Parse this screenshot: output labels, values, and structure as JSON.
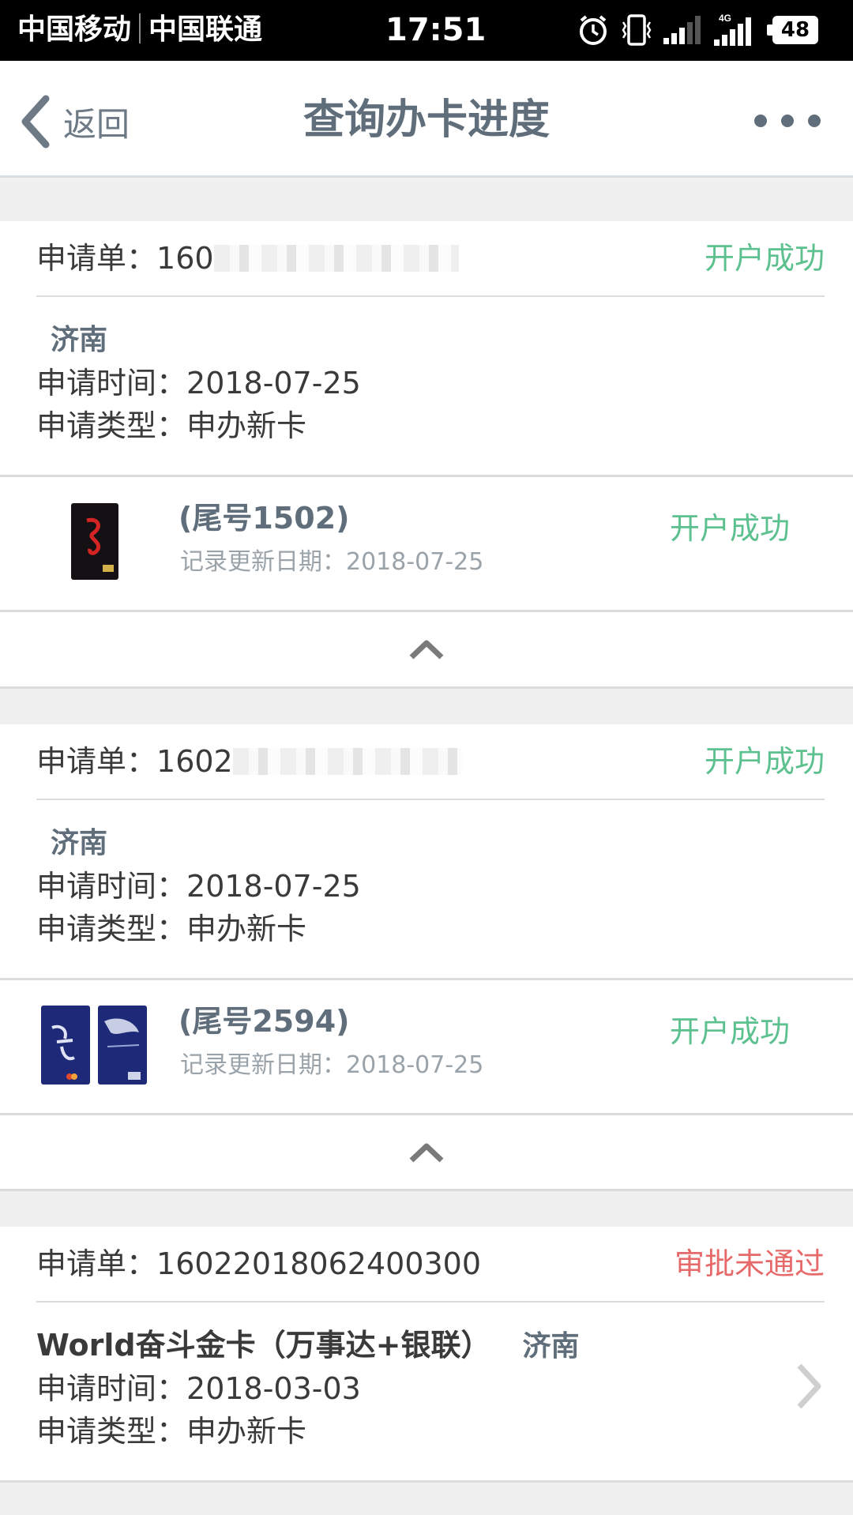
{
  "status_bar": {
    "carrier1": "中国移动",
    "carrier2": "中国联通",
    "time": "17:51",
    "network": "4G",
    "battery": "48"
  },
  "nav": {
    "back_label": "返回",
    "title": "查询办卡进度"
  },
  "applications": [
    {
      "label": "申请单：",
      "number_visible": "160",
      "status": "开户成功",
      "city": "济南",
      "apply_time_label": "申请时间：",
      "apply_time": "2018-07-25",
      "apply_type_label": "申请类型：",
      "apply_type": "申办新卡",
      "card_tail": "(尾号1502)",
      "update_label": "记录更新日期：",
      "update_date": "2018-07-25",
      "card_status": "开户成功"
    },
    {
      "label": "申请单：",
      "number_visible": "1602",
      "status": "开户成功",
      "city": "济南",
      "apply_time_label": "申请时间：",
      "apply_time": "2018-07-25",
      "apply_type_label": "申请类型：",
      "apply_type": "申办新卡",
      "card_tail": "(尾号2594)",
      "update_label": "记录更新日期：",
      "update_date": "2018-07-25",
      "card_status": "开户成功"
    },
    {
      "label": "申请单：",
      "number_visible": "16022018062400300",
      "status": "审批未通过",
      "product": "World奋斗金卡（万事达+银联）",
      "city": "济南",
      "apply_time_label": "申请时间：",
      "apply_time": "2018-03-03",
      "apply_type_label": "申请类型：",
      "apply_type": "申办新卡"
    }
  ],
  "colors": {
    "success": "#5cc08f",
    "rejected": "#e66a6a",
    "title": "#5f6e7a"
  }
}
